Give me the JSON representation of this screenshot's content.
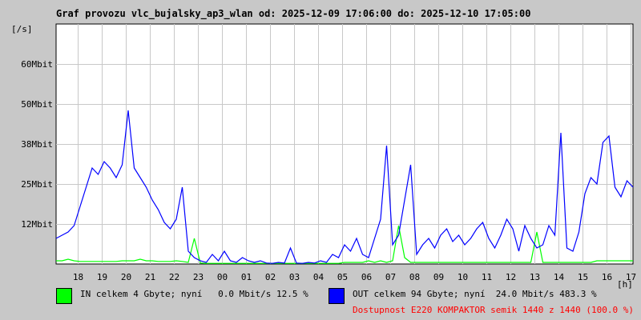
{
  "chart_data": {
    "type": "line",
    "title": "Graf provozu vlc_bujalsky_ap3_wlan od: 2025-12-09 17:06:00 do: 2025-12-10 17:05:00",
    "ylabel": "[/s]",
    "xlabel": "[h]",
    "ylim": [
      0,
      75
    ],
    "y_ticks": [
      {
        "label": "12Mbit",
        "value": 12.5
      },
      {
        "label": "25Mbit",
        "value": 25
      },
      {
        "label": "38Mbit",
        "value": 37.5
      },
      {
        "label": "50Mbit",
        "value": 50
      },
      {
        "label": "60Mbit",
        "value": 62.5
      }
    ],
    "x_range_hours": [
      0,
      24
    ],
    "x_start_offset_hours": 0,
    "x_ticks": [
      "18",
      "19",
      "20",
      "21",
      "22",
      "23",
      "00",
      "01",
      "02",
      "03",
      "04",
      "05",
      "06",
      "07",
      "08",
      "09",
      "10",
      "11",
      "12",
      "13",
      "14",
      "15",
      "16",
      "17"
    ],
    "x_tick_first_offset_hours": 0.9,
    "grid": true,
    "sample_interval_minutes": 15,
    "series": [
      {
        "name": "OUT",
        "color": "#0000ff",
        "unit": "Mbit/s",
        "values": [
          8,
          9,
          10,
          12,
          18,
          24,
          30,
          28,
          32,
          30,
          27,
          31,
          48,
          30,
          27,
          24,
          20,
          17,
          13,
          11,
          14,
          24,
          4,
          2,
          1,
          0.5,
          3,
          1,
          4,
          1,
          0.5,
          2,
          1,
          0.5,
          1,
          0.3,
          0.2,
          0.5,
          0.3,
          5,
          0.3,
          0.2,
          0.5,
          0.3,
          1,
          0.5,
          3,
          2,
          6,
          4,
          8,
          3,
          2,
          8,
          14,
          37,
          6,
          9,
          20,
          31,
          3,
          6,
          8,
          5,
          9,
          11,
          7,
          9,
          6,
          8,
          11,
          13,
          8,
          5,
          9,
          14,
          11,
          4,
          12,
          8,
          5,
          6,
          12,
          9,
          41,
          5,
          4,
          10,
          22,
          27,
          25,
          38,
          40,
          24,
          21,
          26,
          24
        ]
      },
      {
        "name": "IN",
        "color": "#00ff00",
        "unit": "Mbit/s",
        "values": [
          1,
          1,
          1.5,
          1,
          0.8,
          0.8,
          0.8,
          0.8,
          0.8,
          0.8,
          0.8,
          1,
          1,
          1,
          1.5,
          1,
          1,
          0.8,
          0.8,
          0.8,
          1,
          0.8,
          0.5,
          8,
          0.3,
          0.2,
          0.2,
          0.2,
          0.2,
          0.2,
          0.2,
          0.2,
          0.2,
          0.2,
          0.2,
          0.2,
          0.2,
          0.2,
          0.2,
          0.2,
          0.2,
          0.2,
          0.2,
          0.2,
          0.2,
          0.2,
          0.2,
          0.2,
          0.5,
          0.5,
          0.5,
          0.5,
          1,
          0.5,
          1,
          0.5,
          1,
          12,
          2,
          0.5,
          0.5,
          0.5,
          0.5,
          0.5,
          0.5,
          0.5,
          0.5,
          0.5,
          0.5,
          0.5,
          0.5,
          0.5,
          0.5,
          0.5,
          0.5,
          0.5,
          0.5,
          0.5,
          0.5,
          0.5,
          10,
          0.5,
          0.5,
          0.5,
          0.5,
          0.5,
          0.5,
          0.5,
          0.5,
          0.5,
          1,
          1,
          1,
          1,
          1,
          1,
          1
        ]
      }
    ]
  },
  "legend": {
    "in_text": "IN celkem 4 Gbyte; nyní   0.0 Mbit/s 12.5 %",
    "out_text": "OUT celkem 94 Gbyte; nyní  24.0 Mbit/s 483.3 %",
    "availability": "Dostupnost E220 KOMPAKTOR semik 1440 z 1440 (100.0 %)"
  }
}
